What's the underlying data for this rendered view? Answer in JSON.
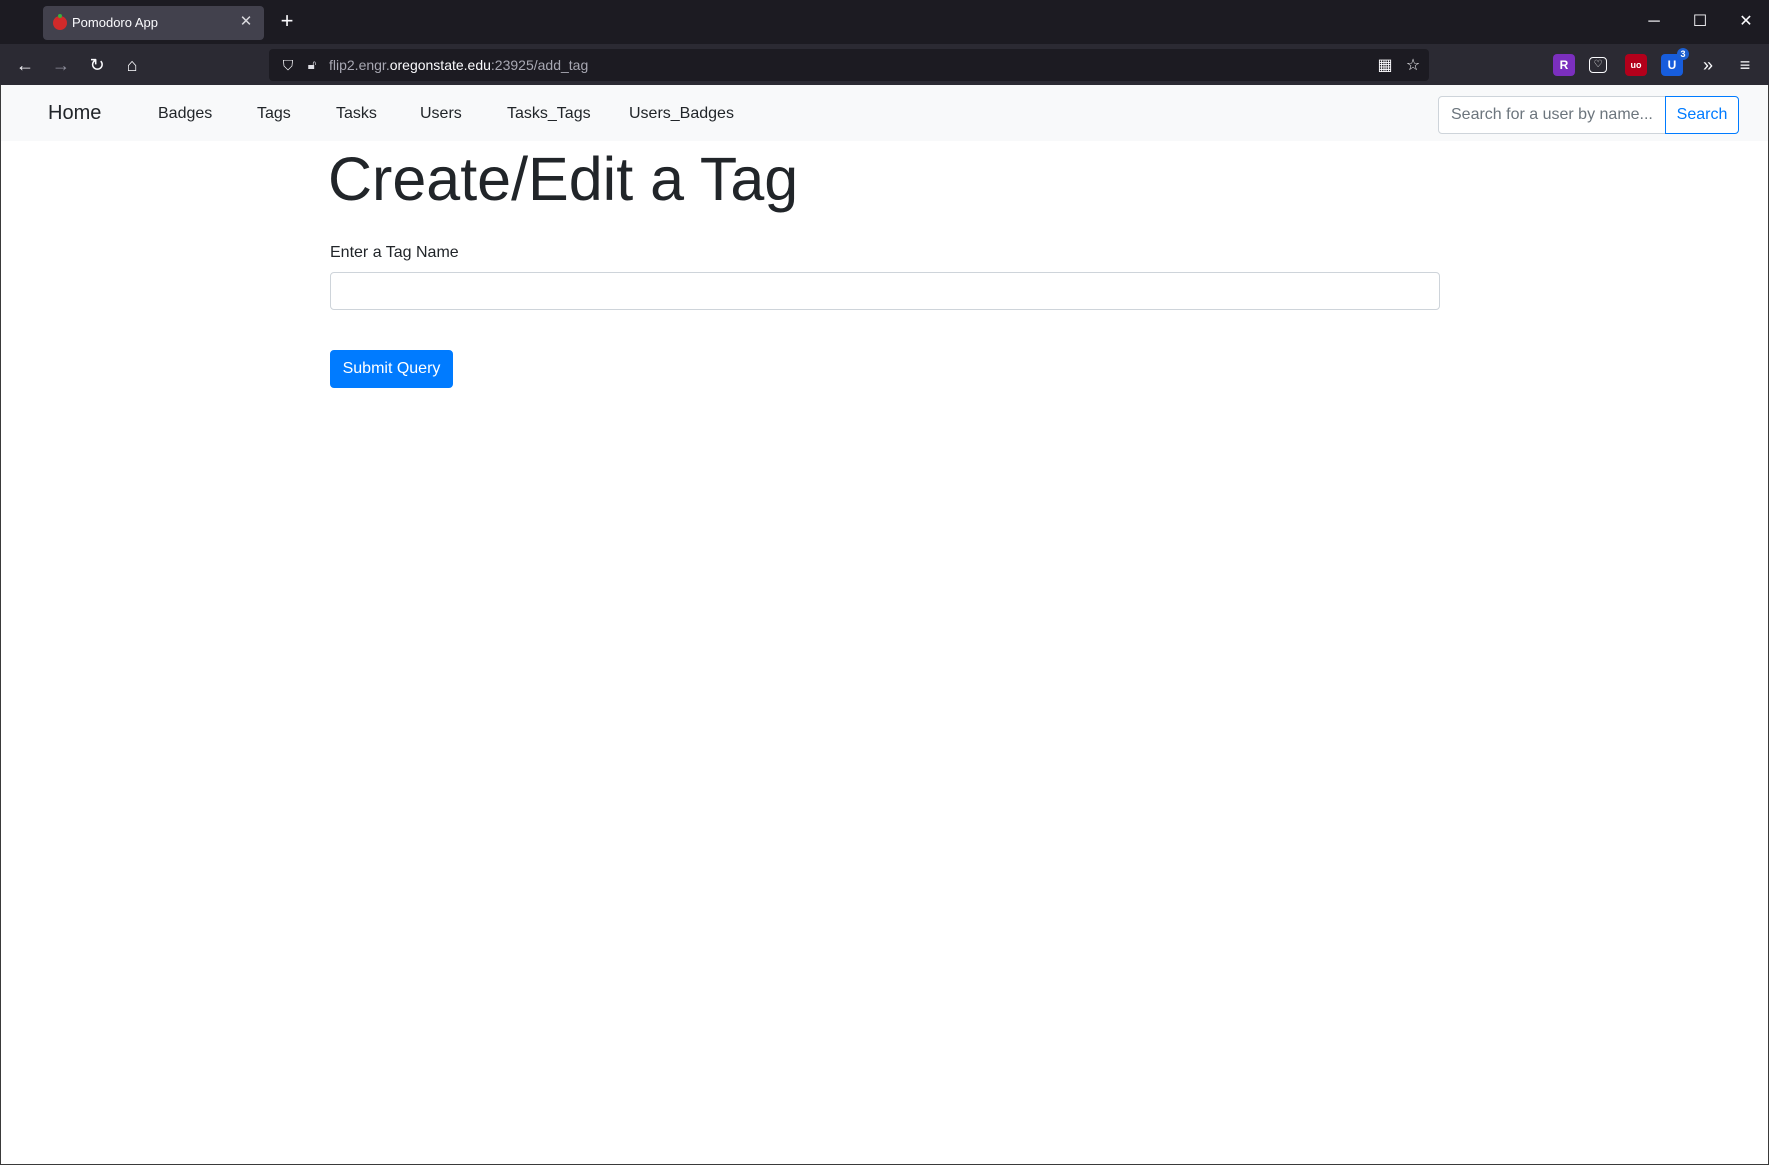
{
  "browser": {
    "tab_title": "Pomodoro App",
    "tab_close": "✕",
    "new_tab": "+",
    "url": {
      "prefix": "flip2.engr.",
      "domain": "oregonstate.edu",
      "suffix": ":23925/add_tag"
    },
    "window_controls": {
      "minimize": "─",
      "maximize": "☐",
      "close": "✕"
    },
    "extensions": [
      {
        "name": "r-extension-icon",
        "glyph": "R",
        "color": "#7b2fbe"
      },
      {
        "name": "pocket-icon",
        "glyph": "♡",
        "color": "#2b2a33"
      },
      {
        "name": "ublock-icon",
        "glyph": "uo",
        "color": "#b3001b"
      },
      {
        "name": "bitwarden-icon",
        "glyph": "U",
        "color": "#175ddc",
        "badge": "3"
      }
    ]
  },
  "nav": {
    "brand": "Home",
    "links": [
      "Badges",
      "Tags",
      "Tasks",
      "Users",
      "Tasks_Tags",
      "Users_Badges"
    ],
    "search": {
      "placeholder": "Search for a user by name...",
      "button": "Search"
    }
  },
  "main": {
    "title": "Create/Edit a Tag",
    "field_label": "Enter a Tag Name",
    "field_value": "",
    "submit": "Submit Query"
  },
  "colors": {
    "primary": "#007bff",
    "navbar_bg": "#f8f9fa",
    "chrome_dark": "#1c1b22",
    "chrome_toolbar": "#2b2a33"
  }
}
